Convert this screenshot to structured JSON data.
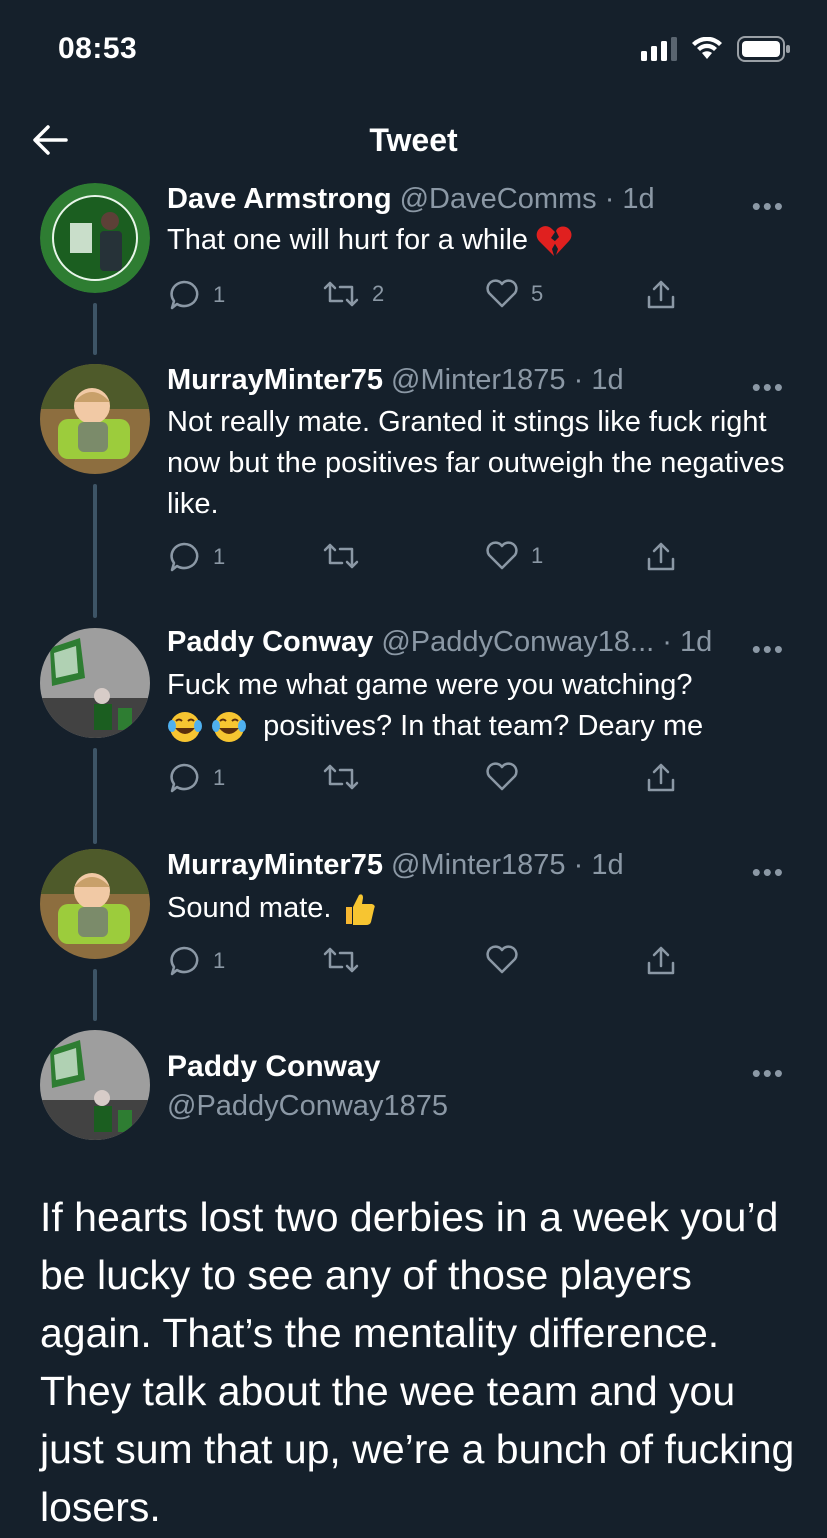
{
  "status_bar": {
    "time": "08:53"
  },
  "nav": {
    "title": "Tweet"
  },
  "replies": [
    {
      "name": "Dave Armstrong",
      "handle": "@DaveComms",
      "time": "1d",
      "text": "That one will hurt for a while",
      "emoji": "broken-heart",
      "counts": {
        "reply": "1",
        "retweet": "2",
        "like": "5"
      }
    },
    {
      "name": "MurrayMinter75",
      "handle": "@Minter1875",
      "time": "1d",
      "text": "Not really mate. Granted it stings like fuck right now but the positives far outweigh the negatives like.",
      "counts": {
        "reply": "1",
        "retweet": "",
        "like": "1"
      }
    },
    {
      "name": "Paddy Conway",
      "handle": "@PaddyConway18...",
      "time": "1d",
      "text_line1": "Fuck me what game were you watching?",
      "text_line2": "positives? In that team? Deary me",
      "emoji": "tears-of-joy",
      "counts": {
        "reply": "1",
        "retweet": "",
        "like": ""
      }
    },
    {
      "name": "MurrayMinter75",
      "handle": "@Minter1875",
      "time": "1d",
      "text": "Sound mate.",
      "emoji": "thumbs-up",
      "counts": {
        "reply": "1",
        "retweet": "",
        "like": ""
      }
    }
  ],
  "main_tweet": {
    "name": "Paddy Conway",
    "handle": "@PaddyConway1875",
    "text": "If hearts lost two derbies in a week you’d be lucky to see any of those players again. That’s the mentality difference. They talk about the wee team and you just sum that up, we’re a bunch of fucking losers."
  },
  "colors": {
    "background": "#15202b",
    "secondary_text": "#8b98a5",
    "thread_line": "#3d5466"
  }
}
